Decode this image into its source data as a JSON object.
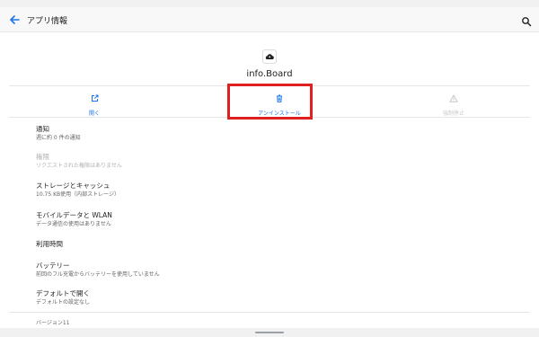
{
  "appbar": {
    "title": "アプリ情報"
  },
  "app": {
    "name": "info.Board"
  },
  "actions": {
    "open": "開く",
    "uninstall": "アンインストール",
    "force_stop": "強制停止"
  },
  "items": [
    {
      "title": "通知",
      "subtitle": "週に約 0 件の通知"
    },
    {
      "title": "権限",
      "subtitle": "リクエストされた権限はありません"
    },
    {
      "title": "ストレージとキャッシュ",
      "subtitle": "10.75 KB使用（内部ストレージ）"
    },
    {
      "title": "モバイルデータと WLAN",
      "subtitle": "データ通信の使用はありません"
    },
    {
      "title": "利用時間",
      "subtitle": ""
    },
    {
      "title": "バッテリー",
      "subtitle": "前回のフル充電からバッテリーを使用していません"
    },
    {
      "title": "デフォルトで開く",
      "subtitle": "デフォルトの設定なし"
    }
  ],
  "version": "バージョン11",
  "colors": {
    "accent": "#1a73e8",
    "highlight": "#e02020",
    "disabled": "#b0b0b0"
  },
  "icons": {
    "back": "arrow-left",
    "search": "magnifier",
    "app": "cloud",
    "open": "open-external",
    "uninstall": "trash",
    "force_stop": "warning-triangle"
  }
}
